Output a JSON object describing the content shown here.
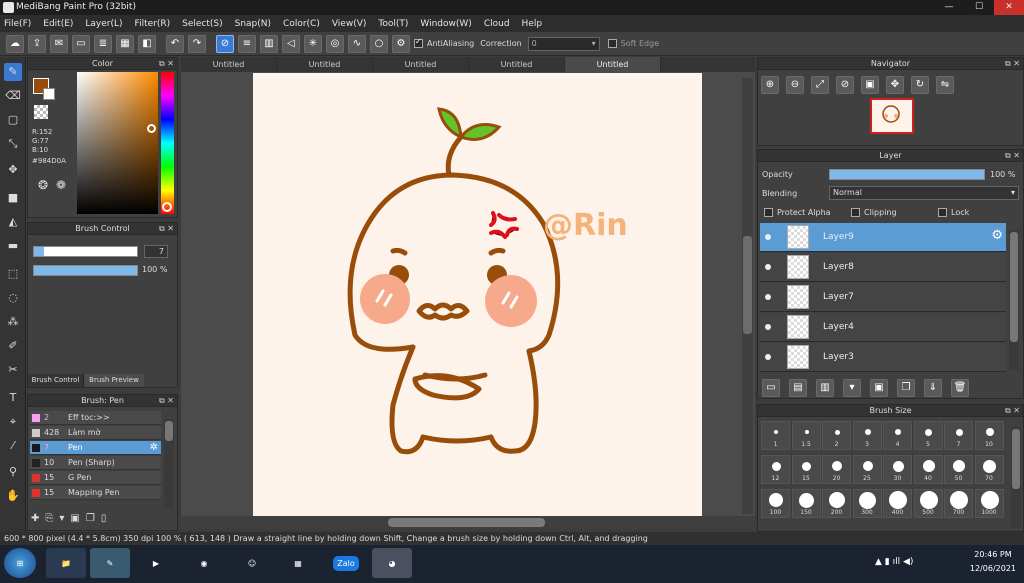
{
  "window": {
    "title": "MediBang Paint Pro (32bit)"
  },
  "menu": [
    "File(F)",
    "Edit(E)",
    "Layer(L)",
    "Filter(R)",
    "Select(S)",
    "Snap(N)",
    "Color(C)",
    "View(V)",
    "Tool(T)",
    "Window(W)",
    "Cloud",
    "Help"
  ],
  "toolbar": {
    "antialiasing_label": "AntiAliasing",
    "antialiasing_checked": true,
    "correction_label": "Correction",
    "correction_value": "0",
    "soft_edge_label": "Soft Edge",
    "soft_edge_checked": false
  },
  "color_panel": {
    "title": "Color",
    "main_color": "#984D0A",
    "r": "R:152",
    "g": "G:77",
    "b": "B:10",
    "hex": "#984D0A"
  },
  "brush_control": {
    "title": "Brush Control",
    "size_value": "7",
    "opacity_value": "100 %",
    "tab_control": "Brush Control",
    "tab_preview": "Brush Preview"
  },
  "brush_list": {
    "title": "Brush: Pen",
    "items": [
      {
        "size": "2",
        "name": "Eff toc:>>",
        "color": "#f5a0f0"
      },
      {
        "size": "428",
        "name": "Làm mờ",
        "color": "#cccccc"
      },
      {
        "size": "7",
        "name": "Pen",
        "color": "#1a1a1a",
        "selected": true
      },
      {
        "size": "10",
        "name": "Pen (Sharp)",
        "color": "#222222"
      },
      {
        "size": "15",
        "name": "G Pen",
        "color": "#e03030"
      },
      {
        "size": "15",
        "name": "Mapping Pen",
        "color": "#e03030"
      }
    ]
  },
  "doc_tabs": [
    "Untitled",
    "Untitled",
    "Untitled",
    "Untitled",
    "Untitled"
  ],
  "artwork": {
    "signature": "@Rin"
  },
  "navigator": {
    "title": "Navigator"
  },
  "layer_panel": {
    "title": "Layer",
    "opacity_label": "Opacity",
    "opacity_value": "100 %",
    "blending_label": "Blending",
    "blending_value": "Normal",
    "protect_alpha": "Protect Alpha",
    "clipping": "Clipping",
    "lock": "Lock",
    "layers": [
      {
        "name": "Layer9",
        "selected": true
      },
      {
        "name": "Layer8"
      },
      {
        "name": "Layer7"
      },
      {
        "name": "Layer4"
      },
      {
        "name": "Layer3"
      }
    ]
  },
  "brush_size": {
    "title": "Brush Size",
    "sizes": [
      "1",
      "1.5",
      "2",
      "3",
      "4",
      "5",
      "7",
      "10",
      "12",
      "15",
      "20",
      "25",
      "30",
      "40",
      "50",
      "70",
      "100",
      "150",
      "200",
      "300",
      "400",
      "500",
      "700",
      "1000"
    ]
  },
  "status": {
    "text": "600 * 800 pixel   (4.4 * 5.8cm)   350 dpi   100 %   ( 613, 148 )   Draw a straight line by holding down Shift, Change a brush size by holding down Ctrl, Alt, and dragging"
  },
  "taskbar": {
    "zalo_label": "Zalo",
    "time": "20:46 PM",
    "date": "12/06/2021"
  }
}
